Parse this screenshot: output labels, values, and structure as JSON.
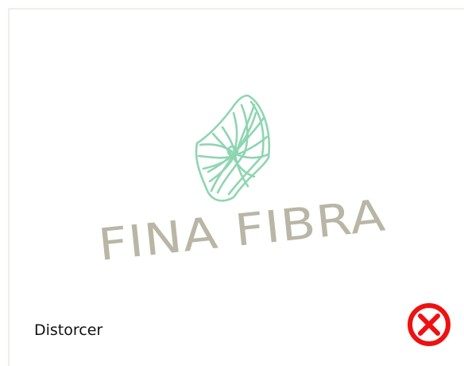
{
  "logo": {
    "text": "FINA FIBRA",
    "icon": "woven-fiber-emblem-icon",
    "text_color": "#b9b6a6",
    "icon_color": "#8fd5b2"
  },
  "caption": {
    "label": "Distorcer"
  },
  "actions": {
    "close_icon": "close-icon",
    "close_color": "#ee1111"
  }
}
